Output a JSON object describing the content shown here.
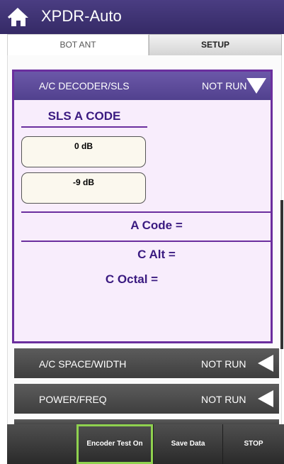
{
  "app": {
    "title": "XPDR-Auto"
  },
  "tabs": [
    {
      "label": "BOT ANT",
      "active": true
    },
    {
      "label": "SETUP",
      "active": false
    }
  ],
  "panel": {
    "title": "A/C DECODER/SLS",
    "status": "NOT RUN",
    "sls_heading": "SLS A CODE",
    "values": [
      "0 dB",
      "-9 dB"
    ],
    "a_code": "A Code =",
    "c_alt": "C Alt =",
    "c_octal": "C Octal ="
  },
  "collapsed_sections": [
    {
      "label": "A/C SPACE/WIDTH",
      "status": "NOT RUN"
    },
    {
      "label": "POWER/FREQ",
      "status": "NOT RUN"
    }
  ],
  "bottom_bar": {
    "encoder_test": "Encoder Test On",
    "save_data": "Save Data",
    "stop": "STOP"
  },
  "colors": {
    "title_bar": "#3d3075",
    "panel_border": "#6b2f9e",
    "panel_bg": "#f8edfc",
    "heading_text": "#3a1a80",
    "highlight": "#8fd14f"
  }
}
